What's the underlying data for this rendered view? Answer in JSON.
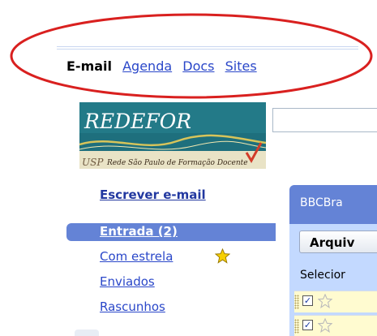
{
  "topnav": {
    "current": "E-mail",
    "links": [
      "Agenda",
      "Docs",
      "Sites"
    ]
  },
  "logo": {
    "title": "REDEFOR",
    "org_abbr": "USP",
    "tagline": "Rede São Paulo de Formação Docente"
  },
  "sidebar": {
    "compose": "Escrever e-mail",
    "items": [
      {
        "label": "Entrada (2)",
        "selected": true
      },
      {
        "label": "Com estrela",
        "icon": "star-icon"
      },
      {
        "label": "Enviados"
      },
      {
        "label": "Rascunhos"
      }
    ]
  },
  "panel": {
    "title": "BBCBra",
    "archive_button": "Arquiv",
    "select_label": "Selecior"
  },
  "colors": {
    "accent": "#6483d6",
    "link": "#2a47c9",
    "panel_bg": "#c3d9ff",
    "oval": "#d9201f"
  }
}
